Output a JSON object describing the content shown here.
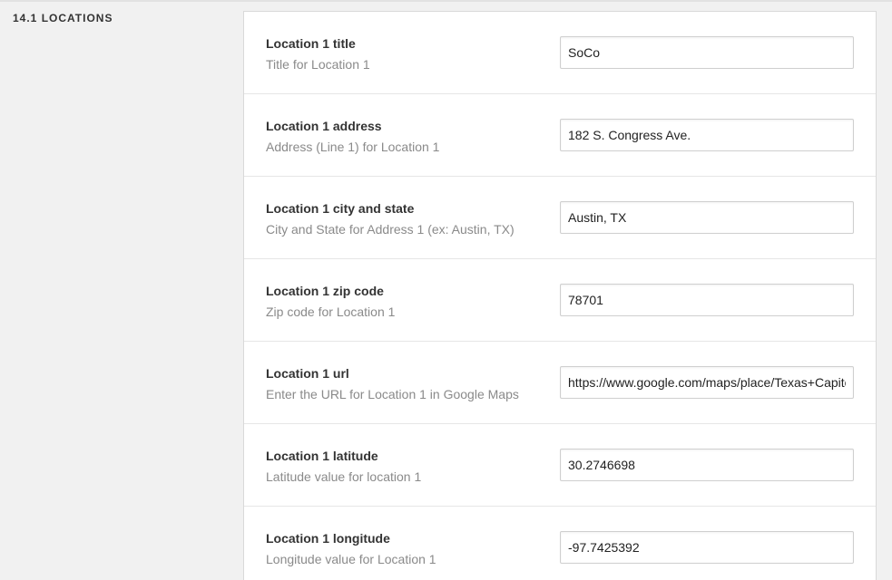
{
  "section": {
    "label": "14.1 LOCATIONS"
  },
  "fields": [
    {
      "label": "Location 1 title",
      "description": "Title for Location 1",
      "value": "SoCo"
    },
    {
      "label": "Location 1 address",
      "description": "Address (Line 1) for Location 1",
      "value": "182 S. Congress Ave."
    },
    {
      "label": "Location 1 city and state",
      "description": "City and State for Address 1 (ex: Austin, TX)",
      "value": "Austin, TX"
    },
    {
      "label": "Location 1 zip code",
      "description": "Zip code for Location 1",
      "value": "78701"
    },
    {
      "label": "Location 1 url",
      "description": "Enter the URL for Location 1 in Google Maps",
      "value": "https://www.google.com/maps/place/Texas+Capitol"
    },
    {
      "label": "Location 1 latitude",
      "description": "Latitude value for location 1",
      "value": "30.2746698"
    },
    {
      "label": "Location 1 longitude",
      "description": "Longitude value for Location 1",
      "value": "-97.7425392"
    }
  ]
}
